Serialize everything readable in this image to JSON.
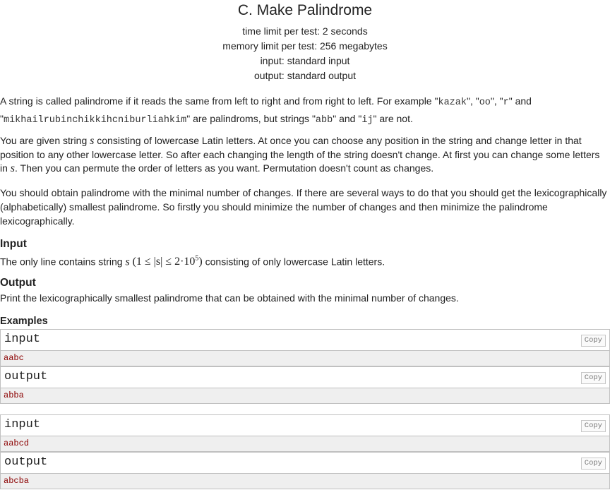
{
  "problem": {
    "title": "C. Make Palindrome",
    "time_limit": "time limit per test: 2 seconds",
    "memory_limit": "memory limit per test: 256 megabytes",
    "input_file": "input: standard input",
    "output_file": "output: standard output"
  },
  "statement": {
    "p1_a": "A string is called palindrome if it reads the same from left to right and from right to left. For example \"",
    "p1_kazak": "kazak",
    "p1_b": "\", \"",
    "p1_oo": "oo",
    "p1_c": "\", \"",
    "p1_r": "r",
    "p1_d": "\" and",
    "p1_e": "\"",
    "p1_long": "mikhailrubinchikkihcniburliahkim",
    "p1_f": "\" are palindroms, but strings \"",
    "p1_abb": "abb",
    "p1_g": "\" and \"",
    "p1_ij": "ij",
    "p1_h": "\" are not.",
    "p2_a": "You are given string ",
    "p2_s": "s",
    "p2_b": " consisting of lowercase Latin letters. At once you can choose any position in the string and change letter in that position to any other lowercase letter. So after each changing the length of the string doesn't change. At first you can change some letters in ",
    "p2_s2": "s",
    "p2_c": ". Then you can permute the order of letters as you want. Permutation doesn't count as changes.",
    "p3": "You should obtain palindrome with the minimal number of changes. If there are several ways to do that you should get the lexicographically (alphabetically) smallest palindrome. So firstly you should minimize the number of changes and then minimize the palindrome lexicographically."
  },
  "input_section": {
    "title": "Input",
    "text_a": "The only line contains string ",
    "var_s": "s",
    "math": "(1 ≤ |s| ≤ 2·10",
    "exp": "5",
    "math_close": ")",
    "text_b": " consisting of only lowercase Latin letters."
  },
  "output_section": {
    "title": "Output",
    "text": "Print the lexicographically smallest palindrome that can be obtained with the minimal number of changes."
  },
  "examples": {
    "title": "Examples",
    "copy_label": "Copy",
    "input_label": "input",
    "output_label": "output",
    "tests": [
      {
        "input": "aabc",
        "output": "abba"
      },
      {
        "input": "aabcd",
        "output": "abcba"
      }
    ]
  }
}
